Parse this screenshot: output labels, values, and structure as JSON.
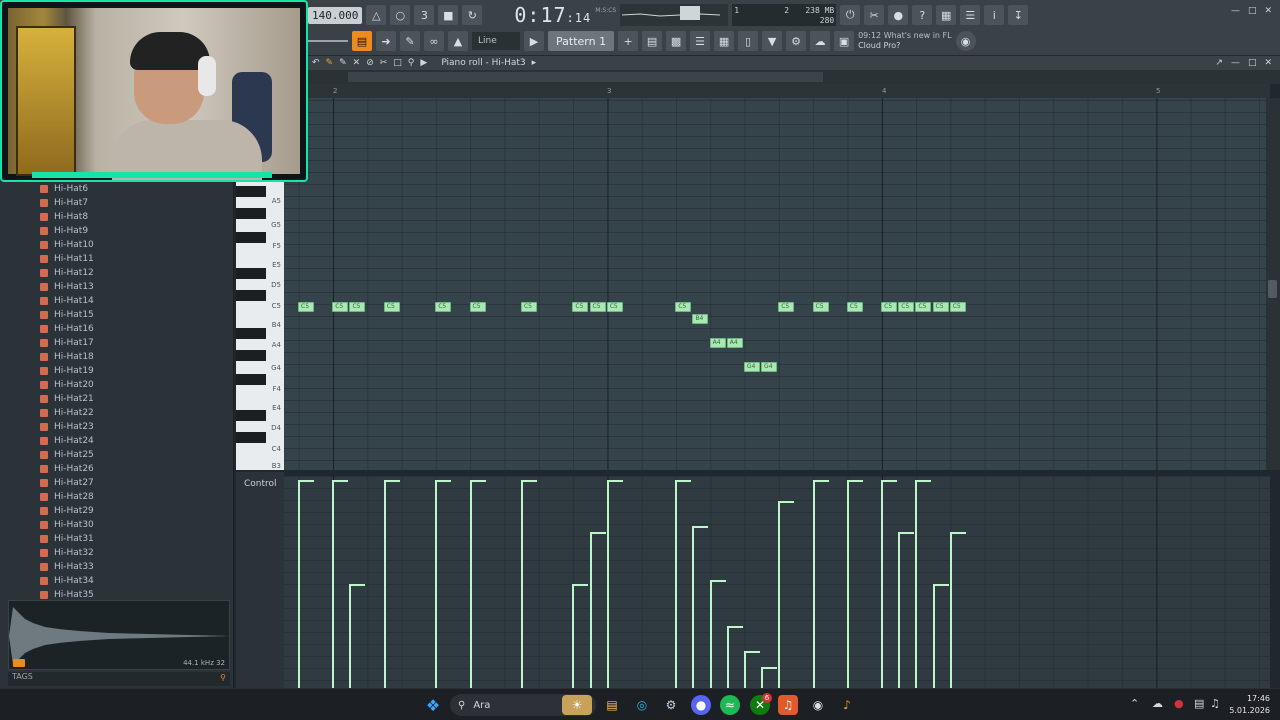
{
  "toolbar": {
    "tempo": "140.000",
    "time_main": "0:17",
    "time_sub": ":14",
    "time_unit": "M:S:CS",
    "cpu_mem": "238 MB",
    "cpu_val": "280",
    "cpu_left": "1",
    "cpu_mid": "2",
    "pattern": "Pattern 1",
    "mode": "Line",
    "news_time": "09:12",
    "news_text": "What's new in FL",
    "news_sub": "Cloud Pro?"
  },
  "piano_roll": {
    "title": "Piano roll - Hi-Hat3",
    "ruler": [
      "2",
      "3",
      "4",
      "5"
    ],
    "keys": [
      "A5",
      "G5",
      "F5",
      "E5",
      "D5",
      "C5",
      "B4",
      "A4",
      "G4",
      "F4",
      "E4",
      "D4",
      "C4",
      "B3"
    ],
    "note_names": {
      "c5": "C5",
      "b4": "B4",
      "a4": "A4",
      "g4": "G4"
    },
    "control_label": "Control"
  },
  "browser": {
    "items": [
      "Hi-Hat6",
      "Hi-Hat7",
      "Hi-Hat8",
      "Hi-Hat9",
      "Hi-Hat10",
      "Hi-Hat11",
      "Hi-Hat12",
      "Hi-Hat13",
      "Hi-Hat14",
      "Hi-Hat15",
      "Hi-Hat16",
      "Hi-Hat17",
      "Hi-Hat18",
      "Hi-Hat19",
      "Hi-Hat20",
      "Hi-Hat21",
      "Hi-Hat22",
      "Hi-Hat23",
      "Hi-Hat24",
      "Hi-Hat25",
      "Hi-Hat26",
      "Hi-Hat27",
      "Hi-Hat28",
      "Hi-Hat29",
      "Hi-Hat30",
      "Hi-Hat31",
      "Hi-Hat32",
      "Hi-Hat33",
      "Hi-Hat34",
      "Hi-Hat35"
    ],
    "sample_info": "44.1 kHz 32",
    "tags_label": "TAGS"
  },
  "taskbar": {
    "search_placeholder": "Ara",
    "time": "17:46",
    "date": "5.01.2026",
    "spotify_badge": "6"
  },
  "notes": [
    {
      "name": "c5",
      "start": 0
    },
    {
      "name": "c5",
      "start": 1
    },
    {
      "name": "c5",
      "start": 1.5
    },
    {
      "name": "c5",
      "start": 2.5
    },
    {
      "name": "c5",
      "start": 4
    },
    {
      "name": "c5",
      "start": 5
    },
    {
      "name": "c5",
      "start": 6.5
    },
    {
      "name": "c5",
      "start": 8
    },
    {
      "name": "c5",
      "start": 8.5
    },
    {
      "name": "c5",
      "start": 9
    },
    {
      "name": "c5",
      "start": 11
    },
    {
      "name": "b4",
      "start": 11.5
    },
    {
      "name": "a4",
      "start": 12
    },
    {
      "name": "a4",
      "start": 12.5
    },
    {
      "name": "g4",
      "start": 13
    },
    {
      "name": "g4",
      "start": 13.5
    },
    {
      "name": "c5",
      "start": 14
    },
    {
      "name": "c5",
      "start": 15
    },
    {
      "name": "c5",
      "start": 16
    },
    {
      "name": "c5",
      "start": 17
    },
    {
      "name": "c5",
      "start": 17.5
    },
    {
      "name": "c5",
      "start": 18
    },
    {
      "name": "c5",
      "start": 18.5
    },
    {
      "name": "c5",
      "start": 19
    }
  ],
  "velocities": [
    1.0,
    1.0,
    0.5,
    1.0,
    1.0,
    1.0,
    1.0,
    0.5,
    0.75,
    1.0,
    1.0,
    0.78,
    0.52,
    0.3,
    0.18,
    0.1,
    0.9,
    1.0,
    1.0,
    1.0,
    0.75,
    1.0,
    0.5,
    0.75
  ]
}
